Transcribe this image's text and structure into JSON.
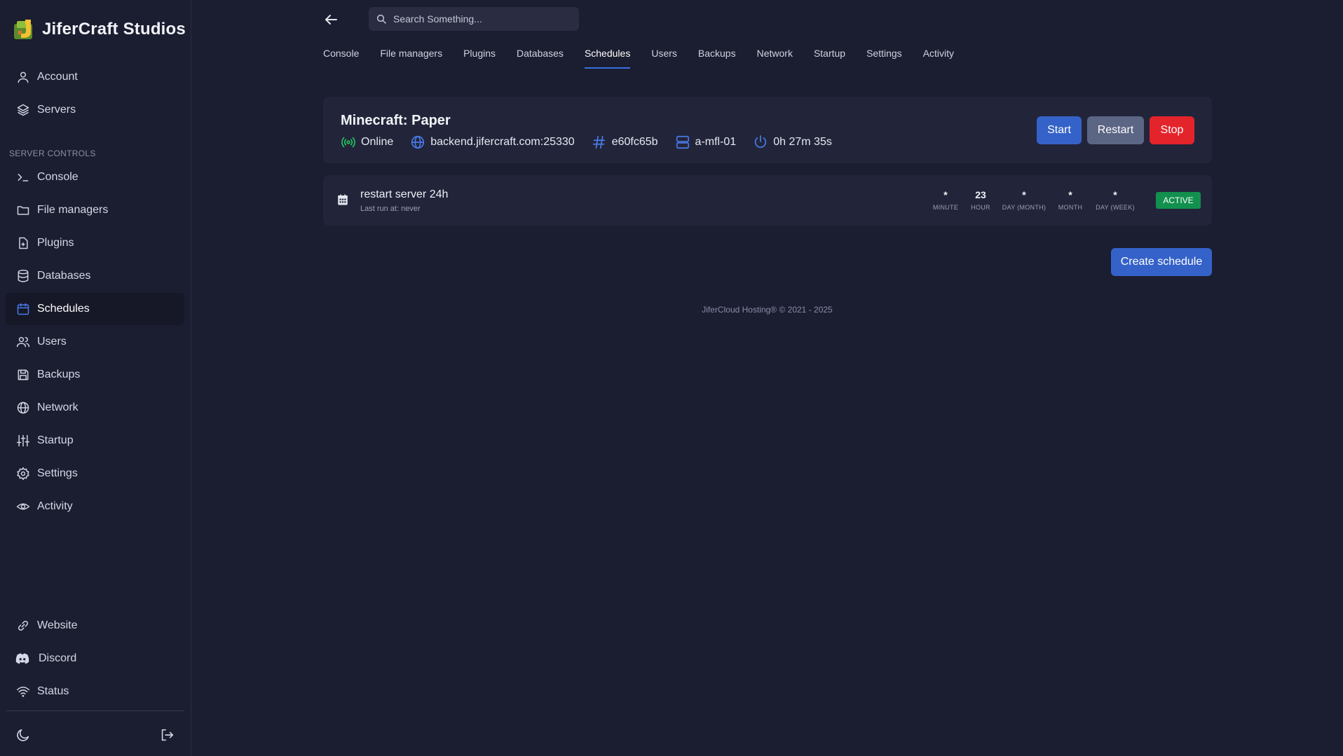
{
  "brand": {
    "name": "JiferCraft Studios"
  },
  "sidebar": {
    "top_items": [
      {
        "label": "Account",
        "icon": "user-icon"
      },
      {
        "label": "Servers",
        "icon": "layers-icon"
      }
    ],
    "section_label": "SERVER CONTROLS",
    "control_items": [
      {
        "label": "Console",
        "icon": "terminal-icon"
      },
      {
        "label": "File managers",
        "icon": "folder-icon"
      },
      {
        "label": "Plugins",
        "icon": "file-plus-icon"
      },
      {
        "label": "Databases",
        "icon": "database-icon"
      },
      {
        "label": "Schedules",
        "icon": "calendar-icon",
        "active": true
      },
      {
        "label": "Users",
        "icon": "users-icon"
      },
      {
        "label": "Backups",
        "icon": "save-icon"
      },
      {
        "label": "Network",
        "icon": "globe-icon"
      },
      {
        "label": "Startup",
        "icon": "sliders-icon"
      },
      {
        "label": "Settings",
        "icon": "gear-icon"
      },
      {
        "label": "Activity",
        "icon": "eye-icon"
      }
    ],
    "link_items": [
      {
        "label": "Website",
        "icon": "link-icon"
      },
      {
        "label": "Discord",
        "icon": "discord-icon"
      },
      {
        "label": "Status",
        "icon": "wifi-icon"
      }
    ]
  },
  "search": {
    "placeholder": "Search Something..."
  },
  "tabs": [
    "Console",
    "File managers",
    "Plugins",
    "Databases",
    "Schedules",
    "Users",
    "Backups",
    "Network",
    "Startup",
    "Settings",
    "Activity"
  ],
  "active_tab": "Schedules",
  "server": {
    "name": "Minecraft: Paper",
    "status": "Online",
    "address": "backend.jifercraft.com:25330",
    "id": "e60fc65b",
    "node": "a-mfl-01",
    "uptime": "0h 27m 35s",
    "start_label": "Start",
    "restart_label": "Restart",
    "stop_label": "Stop"
  },
  "schedule": {
    "name": "restart server 24h",
    "last_run": "Last run at: never",
    "cron": [
      {
        "value": "*",
        "label": "MINUTE"
      },
      {
        "value": "23",
        "label": "HOUR"
      },
      {
        "value": "*",
        "label": "DAY (MONTH)"
      },
      {
        "value": "*",
        "label": "MONTH"
      },
      {
        "value": "*",
        "label": "DAY (WEEK)"
      }
    ],
    "status": "ACTIVE"
  },
  "create_label": "Create schedule",
  "footer": "JiferCloud Hosting® © 2021 - 2025",
  "colors": {
    "accent": "#3562c8",
    "danger": "#e3242b",
    "success": "#12904e",
    "online": "#22c55e",
    "icon_blue": "#4a7bea"
  }
}
